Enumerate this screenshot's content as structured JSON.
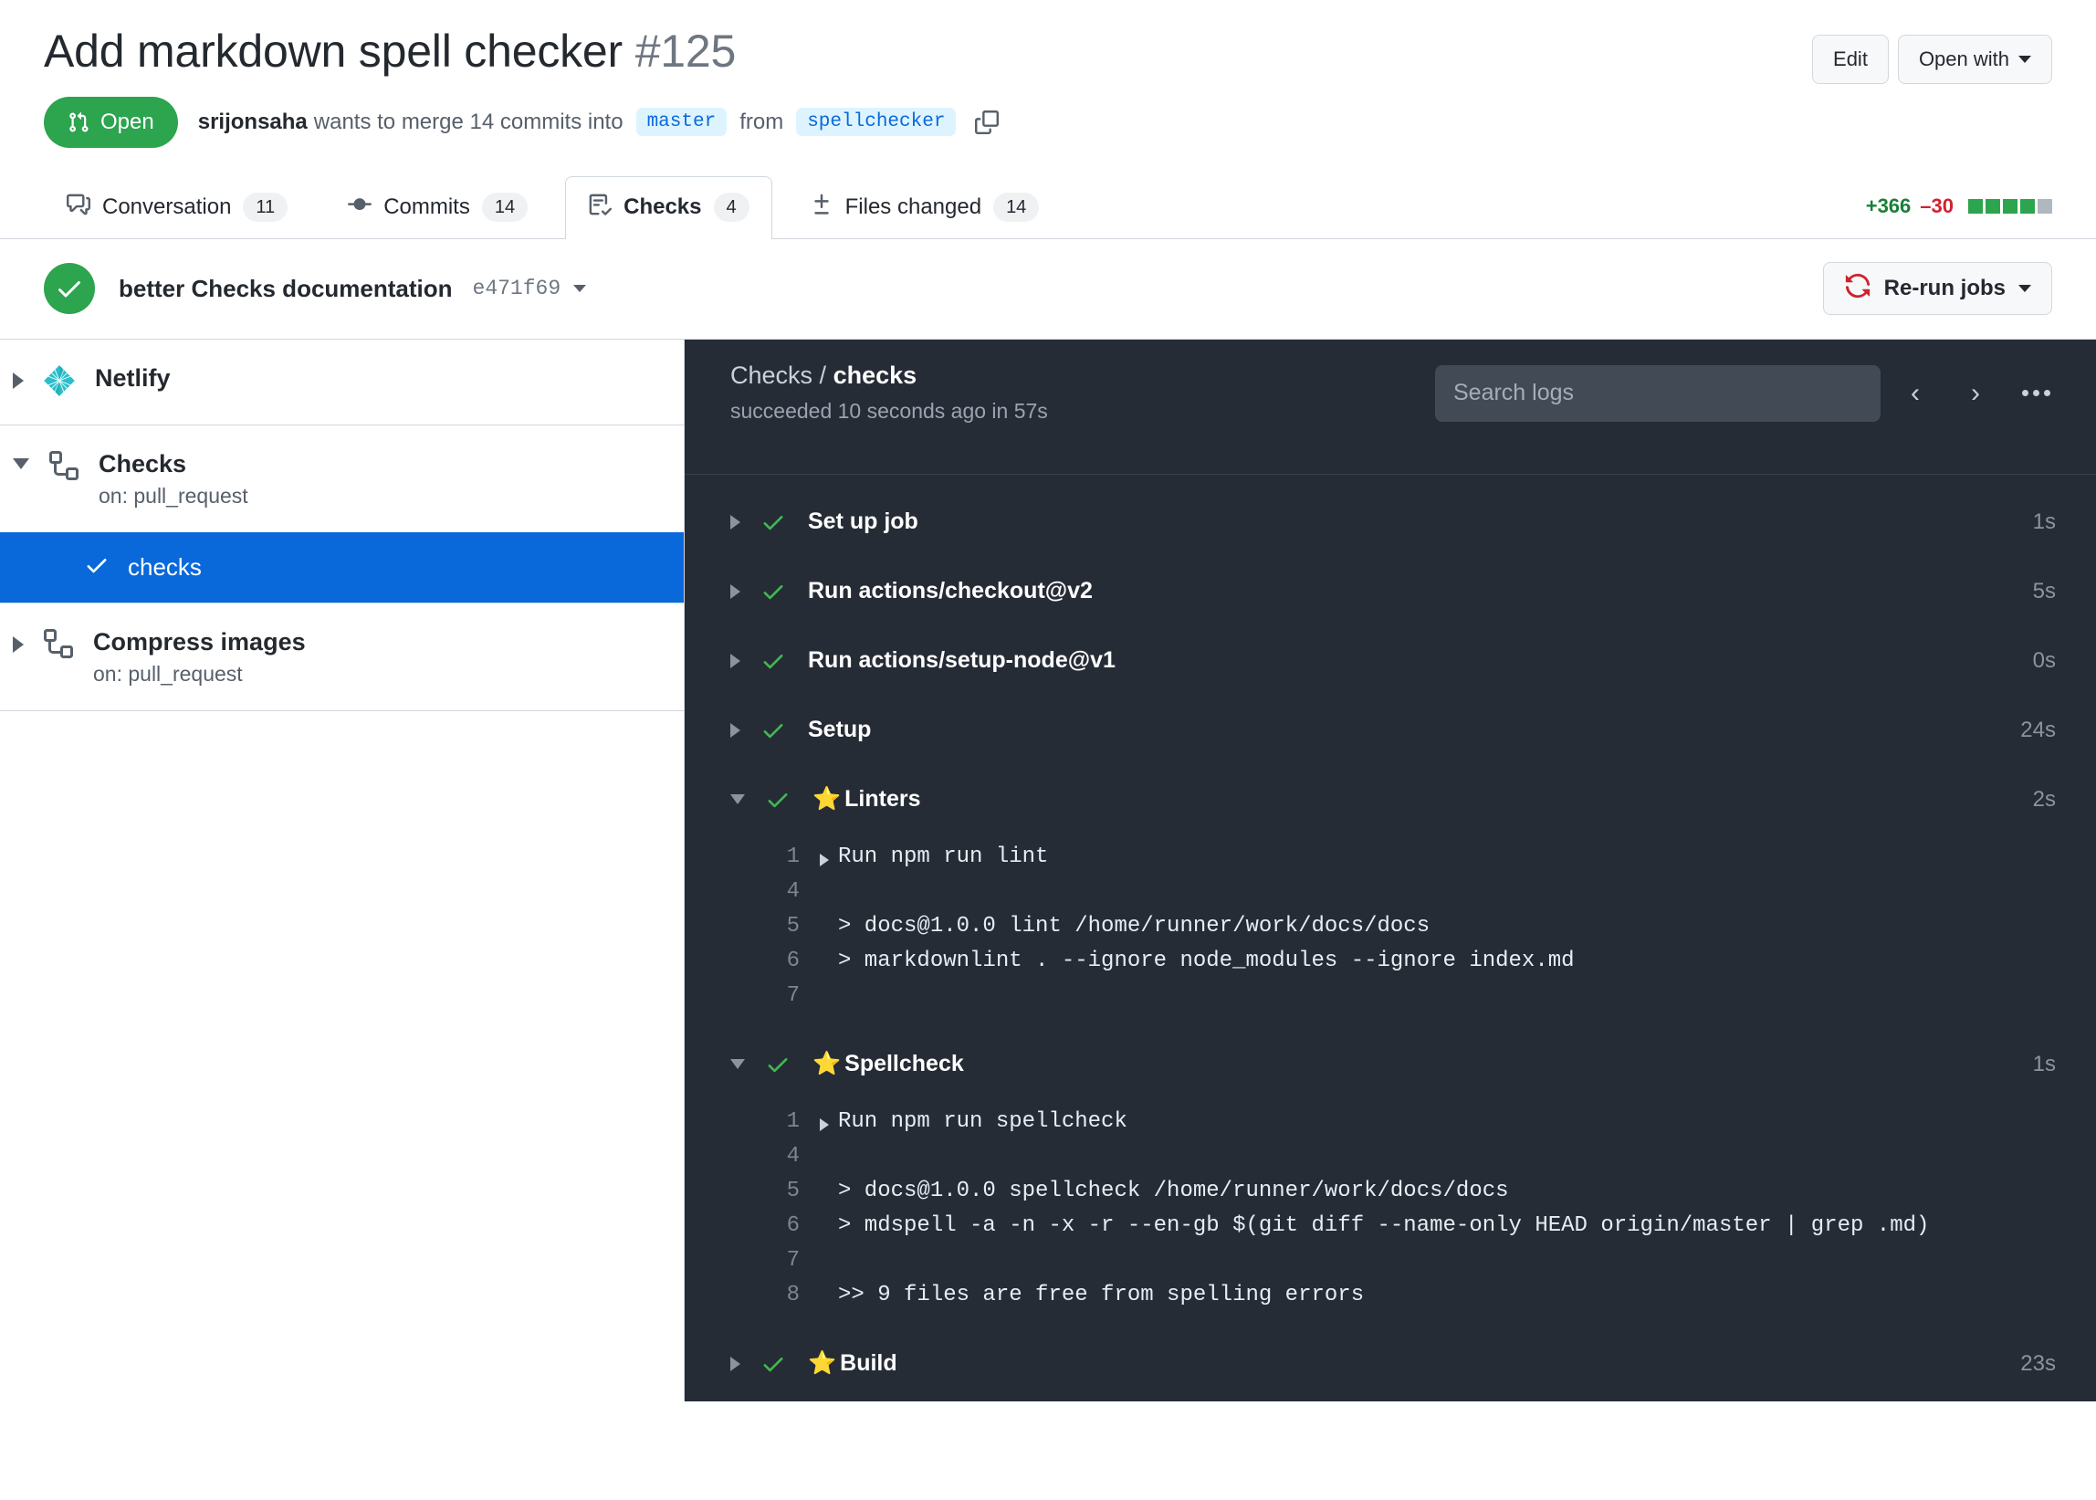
{
  "header": {
    "title": "Add markdown spell checker",
    "number": "#125",
    "edit_label": "Edit",
    "open_with_label": "Open with",
    "state_label": "Open",
    "author": "srijonsaha",
    "merge_text_1": "wants to merge 14 commits into",
    "base_branch": "master",
    "merge_text_2": "from",
    "head_branch": "spellchecker"
  },
  "tabs": [
    {
      "label": "Conversation",
      "count": "11",
      "icon": "comment-discussion-icon",
      "active": false
    },
    {
      "label": "Commits",
      "count": "14",
      "icon": "git-commit-icon",
      "active": false
    },
    {
      "label": "Checks",
      "count": "4",
      "icon": "checklist-icon",
      "active": true
    },
    {
      "label": "Files changed",
      "count": "14",
      "icon": "diff-icon",
      "active": false
    }
  ],
  "diffstat": {
    "additions": "+366",
    "deletions": "–30",
    "blocks": [
      "#2da44e",
      "#2da44e",
      "#2da44e",
      "#2da44e",
      "#afb8c1"
    ]
  },
  "commit_bar": {
    "message": "better Checks documentation",
    "sha": "e471f69",
    "status_color": "#2da44e",
    "rerun_label": "Re-run jobs"
  },
  "sidebar": {
    "groups": [
      {
        "name": "Netlify",
        "subtitle": "",
        "icon": "netlify-icon",
        "expanded": false,
        "children": []
      },
      {
        "name": "Checks",
        "subtitle": "on: pull_request",
        "icon": "workflow-icon",
        "expanded": true,
        "children": [
          {
            "label": "checks",
            "status": "success",
            "selected": true
          }
        ]
      },
      {
        "name": "Compress images",
        "subtitle": "on: pull_request",
        "icon": "workflow-icon",
        "expanded": false,
        "children": []
      }
    ]
  },
  "log": {
    "breadcrumb_parent": "Checks /",
    "breadcrumb_current": "checks",
    "status_line": "succeeded 10 seconds ago in 57s",
    "search_placeholder": "Search logs",
    "prev_label": "‹",
    "next_label": "›",
    "steps": [
      {
        "name": "Set up job",
        "time": "1s",
        "expanded": false,
        "star": false,
        "status": "success",
        "lines": []
      },
      {
        "name": "Run actions/checkout@v2",
        "time": "5s",
        "expanded": false,
        "star": false,
        "status": "success",
        "lines": []
      },
      {
        "name": "Run actions/setup-node@v1",
        "time": "0s",
        "expanded": false,
        "star": false,
        "status": "success",
        "lines": []
      },
      {
        "name": "Setup",
        "time": "24s",
        "expanded": false,
        "star": false,
        "status": "success",
        "lines": []
      },
      {
        "name": "Linters",
        "time": "2s",
        "expanded": true,
        "star": true,
        "status": "success",
        "lines": [
          {
            "no": "1",
            "text": "Run npm run lint",
            "arrow": true
          },
          {
            "no": "4",
            "text": "",
            "arrow": false
          },
          {
            "no": "5",
            "text": "> docs@1.0.0 lint /home/runner/work/docs/docs",
            "arrow": false
          },
          {
            "no": "6",
            "text": "> markdownlint . --ignore node_modules --ignore index.md",
            "arrow": false
          },
          {
            "no": "7",
            "text": "",
            "arrow": false
          }
        ]
      },
      {
        "name": "Spellcheck",
        "time": "1s",
        "expanded": true,
        "star": true,
        "status": "success",
        "lines": [
          {
            "no": "1",
            "text": "Run npm run spellcheck",
            "arrow": true
          },
          {
            "no": "4",
            "text": "",
            "arrow": false
          },
          {
            "no": "5",
            "text": "> docs@1.0.0 spellcheck /home/runner/work/docs/docs",
            "arrow": false
          },
          {
            "no": "6",
            "text": "> mdspell -a -n -x -r --en-gb $(git diff --name-only HEAD origin/master | grep .md)",
            "arrow": false
          },
          {
            "no": "7",
            "text": "",
            "arrow": false
          },
          {
            "no": "8",
            "text": ">> 9 files are free from spelling errors",
            "arrow": false
          }
        ]
      },
      {
        "name": "Build",
        "time": "23s",
        "expanded": false,
        "star": true,
        "status": "success",
        "lines": []
      }
    ]
  }
}
